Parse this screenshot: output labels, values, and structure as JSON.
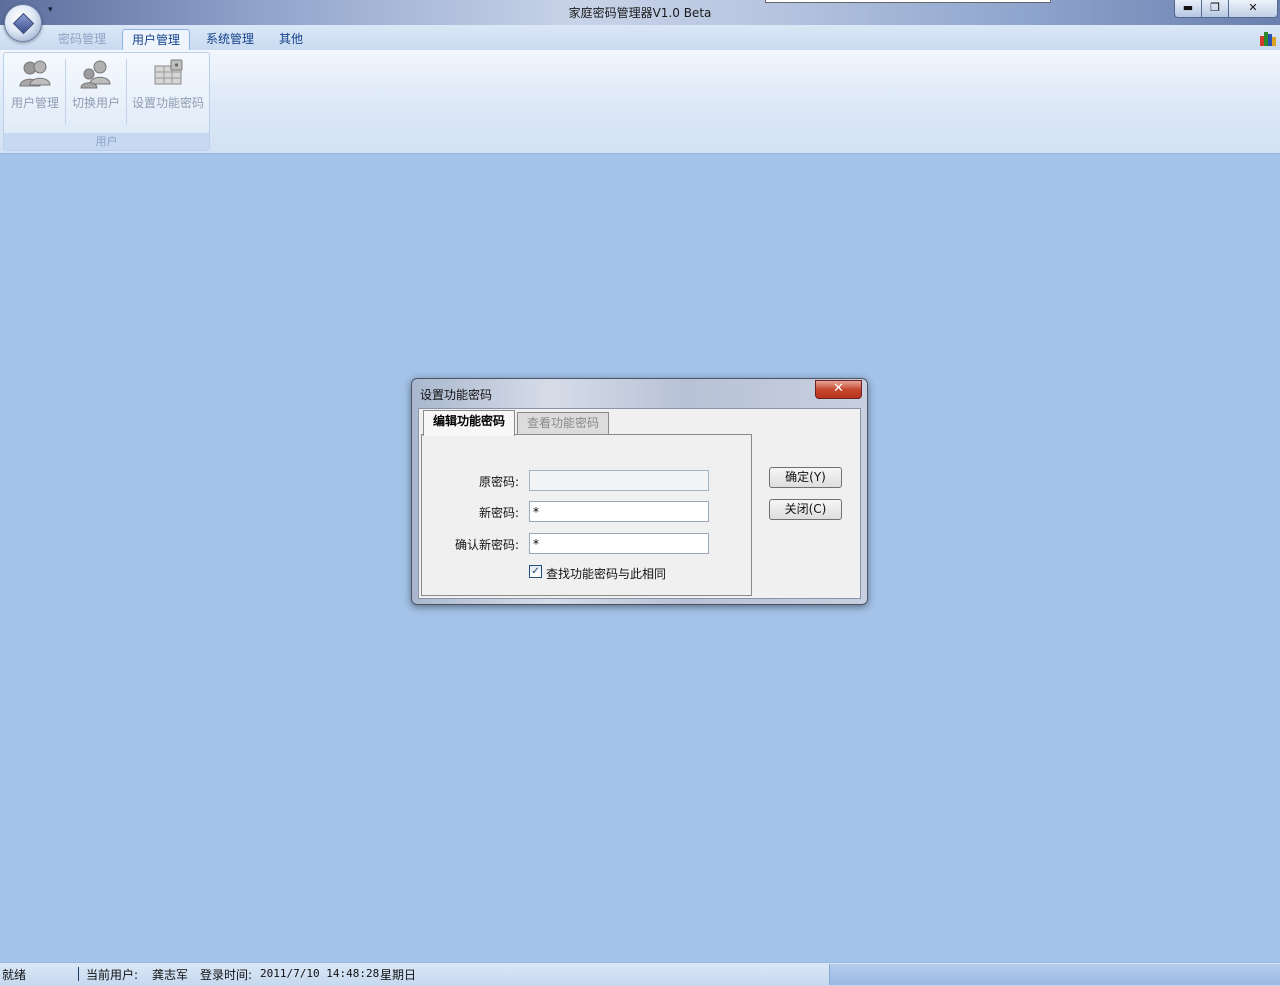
{
  "window": {
    "title": "家庭密码管理器V1.0 Beta",
    "minimize": "▬",
    "restore": "❐",
    "close": "✕"
  },
  "ribbon": {
    "tabs": [
      {
        "label": "密码管理",
        "state": "disabled"
      },
      {
        "label": "用户管理",
        "state": "active"
      },
      {
        "label": "系统管理",
        "state": "normal"
      },
      {
        "label": "其他",
        "state": "normal"
      }
    ],
    "group": {
      "label": "用户",
      "buttons": [
        {
          "label": "用户管理",
          "icon": "users-icon"
        },
        {
          "label": "切换用户",
          "icon": "switch-user-icon"
        },
        {
          "label": "设置功能密码",
          "icon": "set-function-password-icon"
        }
      ]
    }
  },
  "dialog": {
    "title": "设置功能密码",
    "close": "✕",
    "tabs": [
      {
        "label": "编辑功能密码",
        "state": "active"
      },
      {
        "label": "查看功能密码",
        "state": "inactive"
      }
    ],
    "fields": {
      "old_password_label": "原密码:",
      "old_password_value": "",
      "new_password_label": "新密码:",
      "new_password_value": "*",
      "confirm_password_label": "确认新密码:",
      "confirm_password_value": "*"
    },
    "checkbox": {
      "label": "查找功能密码与此相同",
      "checked": true,
      "mark": "✓"
    },
    "buttons": {
      "ok": "确定(Y)",
      "close": "关闭(C)"
    }
  },
  "status": {
    "ready": "就绪",
    "current_user_label": "当前用户:",
    "current_user": "龚志军",
    "login_time_label": "登录时间:",
    "login_time": "2011/7/10 14:48:28",
    "weekday": "星期日"
  },
  "colors": {
    "workspace": "#a4c3e8",
    "ribbon_text": "#15428b",
    "close_button": "#c5482f"
  }
}
